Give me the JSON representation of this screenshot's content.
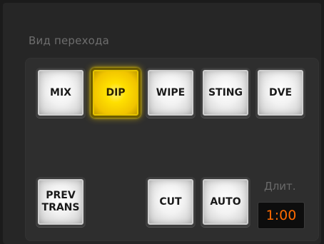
{
  "section": {
    "title": "Вид перехода"
  },
  "transition_buttons": {
    "mix": "MIX",
    "dip": "DIP",
    "wipe": "WIPE",
    "sting": "STING",
    "dve": "DVE"
  },
  "actions": {
    "prev_trans_line1": "PREV",
    "prev_trans_line2": "TRANS",
    "cut": "CUT",
    "auto": "AUTO"
  },
  "duration": {
    "label": "Длит.",
    "value": "1:00"
  },
  "selected_transition": "DIP",
  "colors": {
    "selected": "#ffd400",
    "duration_text": "#ff6a00",
    "label_text": "#6e6e6e"
  }
}
